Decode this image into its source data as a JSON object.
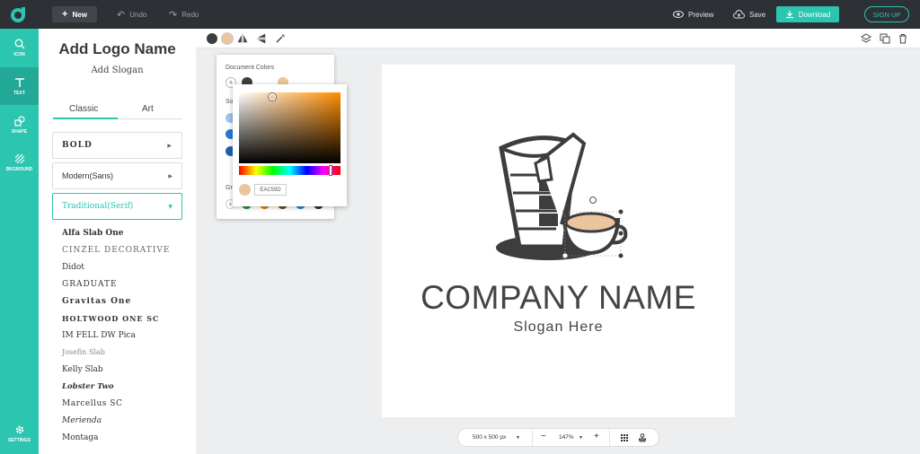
{
  "topbar": {
    "new_label": "New",
    "undo_label": "Undo",
    "redo_label": "Redo",
    "preview_label": "Preview",
    "save_label": "Save",
    "download_label": "Download",
    "signup_label": "SIGN UP"
  },
  "nav": [
    {
      "label": "ICON",
      "icon": "search-icon"
    },
    {
      "label": "TEXT",
      "icon": "text-icon"
    },
    {
      "label": "SHAPE",
      "icon": "shape-icon"
    },
    {
      "label": "BKGROUND",
      "icon": "background-icon"
    },
    {
      "label": "SETTINGS",
      "icon": "gear-icon"
    }
  ],
  "panel": {
    "brand": "Add Logo Name",
    "slogan": "Add Slogan",
    "tabs": [
      "Classic",
      "Art"
    ],
    "categories": [
      "BOLD",
      "Modern(Sans)",
      "Traditional(Serif)"
    ],
    "fonts": [
      "Alfa Slab One",
      "CINZEL DECORATIVE",
      "Didot",
      "GRADUATE",
      "Gravitas One",
      "HOLTWOOD ONE SC",
      "IM FELL DW Pica",
      "Josefin Slab",
      "Kelly Slab",
      "Lobster Two",
      "Marcellus SC",
      "Merienda",
      "Montaga"
    ]
  },
  "popup": {
    "doc_title": "Document Colors",
    "sol_label": "So",
    "gr_label": "Gr",
    "hex_value": "EAC59D"
  },
  "canvas": {
    "company_name": "COMPANY NAME",
    "slogan": "Slogan Here"
  },
  "zoom": {
    "size_label": "500 x 500 px",
    "zoom_label": "147%"
  },
  "colors": {
    "accent": "#2bc5b0",
    "dark": "#3d3d3d",
    "tan": "#eac59d"
  }
}
